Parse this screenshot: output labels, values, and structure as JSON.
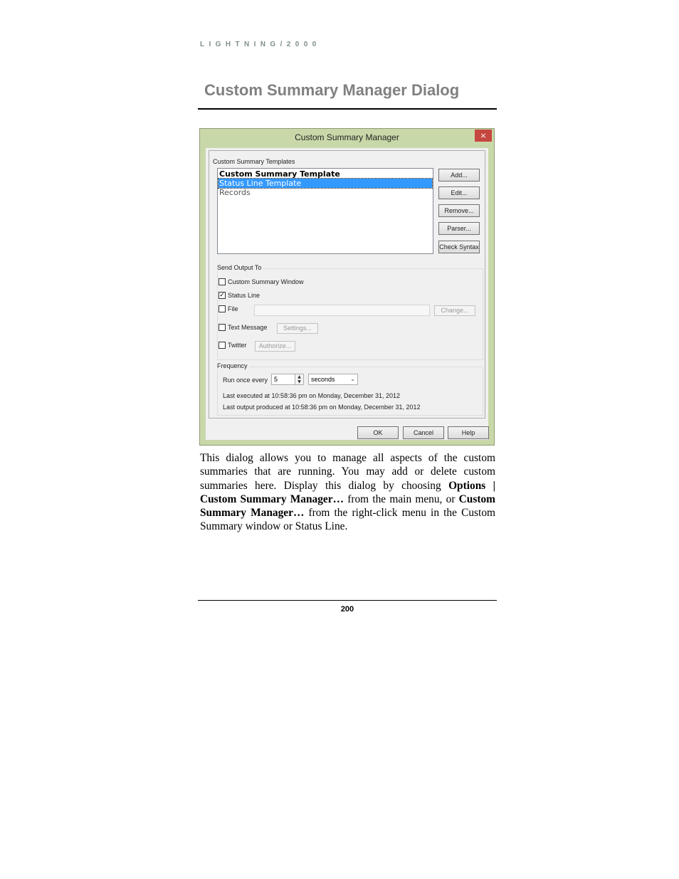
{
  "header": {
    "running_title": "LIGHTNING/2000"
  },
  "section": {
    "title": "Custom Summary Manager Dialog"
  },
  "dialog": {
    "title": "Custom Summary Manager",
    "close_glyph": "×",
    "templates_label": "Custom Summary Templates",
    "templates": [
      "Custom Summary Template",
      "Status Line Template",
      "Records"
    ],
    "selected_template_index": 1,
    "buttons": {
      "add": "Add...",
      "edit": "Edit...",
      "remove": "Remove...",
      "parser": "Parser...",
      "check_syntax": "Check Syntax"
    },
    "send_output": {
      "label": "Send Output To",
      "custom_summary_window": {
        "label": "Custom Summary Window",
        "checked": false
      },
      "status_line": {
        "label": "Status Line",
        "checked": true
      },
      "file": {
        "label": "File",
        "checked": false,
        "value": "",
        "change_button": "Change..."
      },
      "text_message": {
        "label": "Text Message",
        "checked": false,
        "settings_button": "Settings..."
      },
      "twitter": {
        "label": "Twitter",
        "checked": false,
        "authorize_button": "Authorize..."
      },
      "check_glyph": "✓"
    },
    "frequency": {
      "label": "Frequency",
      "run_label": "Run once every",
      "interval_value": "5",
      "unit": "seconds",
      "last_executed": "Last executed at 10:58:36 pm on Monday, December 31, 2012",
      "last_output": "Last output produced at 10:58:36 pm on Monday, December 31, 2012"
    },
    "footer_buttons": {
      "ok": "OK",
      "cancel": "Cancel",
      "help": "Help"
    }
  },
  "body": {
    "p1": "This dialog allows you to manage all aspects of the custom summaries that are running.  You may add or delete custom summaries here.  Display this dialog by choosing ",
    "b1": "Options | Custom Summary Manager…",
    "p2": " from the main menu, or ",
    "b2": "Custom Summary Manager…",
    "p3": " from the right-click menu in the Custom Summary window or Status Line."
  },
  "footer": {
    "page_number": "200"
  }
}
